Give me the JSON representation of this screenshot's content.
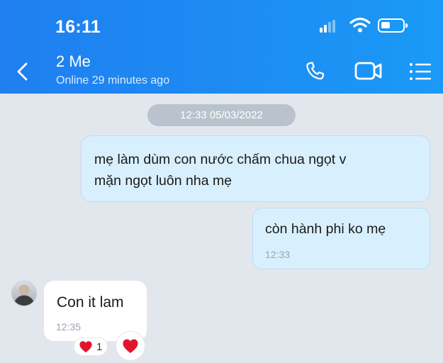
{
  "status_bar": {
    "time": "16:11"
  },
  "chat_header": {
    "contact_name": "2 Me",
    "contact_status": "Online 29 minutes ago"
  },
  "date_separator": "12:33 05/03/2022",
  "messages": [
    {
      "direction": "outgoing",
      "lines": [
        "mẹ làm dùm con nước chấm chua ngọt v",
        "mặn ngọt luôn nha mẹ"
      ]
    },
    {
      "direction": "outgoing",
      "text": "còn hành phi ko mẹ",
      "time": "12:33"
    },
    {
      "direction": "incoming",
      "text": "Con it lam",
      "time": "12:35"
    }
  ],
  "reaction": {
    "count": "1"
  },
  "icons": {
    "back": "chevron-left-icon",
    "call": "phone-icon",
    "video": "video-camera-icon",
    "menu": "list-menu-icon",
    "reaction": "heart-icon"
  },
  "colors": {
    "header": "#1d8cf3",
    "chat_background": "#e2e7ee",
    "outgoing_bubble": "#d8f0fe",
    "incoming_bubble": "#ffffff",
    "heart": "#e2142d"
  }
}
